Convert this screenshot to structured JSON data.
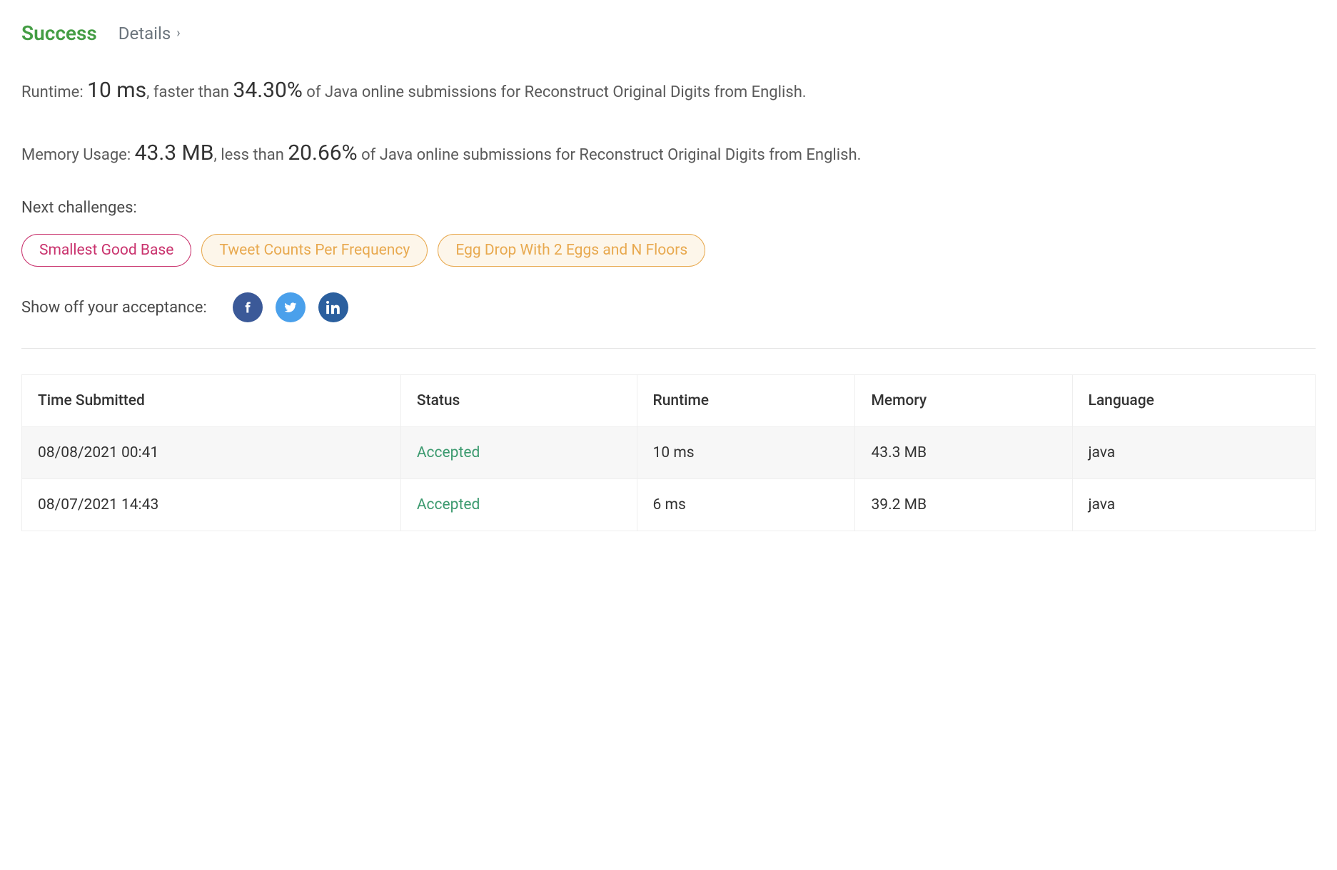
{
  "header": {
    "status": "Success",
    "details_label": "Details"
  },
  "runtime": {
    "label": "Runtime: ",
    "value": "10 ms",
    "comma": ", faster than ",
    "percent": "34.30%",
    "tail": " of Java online submissions for Reconstruct Original Digits from English."
  },
  "memory": {
    "label": "Memory Usage: ",
    "value": "43.3 MB",
    "comma": ", less than ",
    "percent": "20.66%",
    "tail": " of Java online submissions for Reconstruct Original Digits from English."
  },
  "next_challenges": {
    "label": "Next challenges:",
    "items": [
      {
        "text": "Smallest Good Base",
        "style": "pink"
      },
      {
        "text": "Tweet Counts Per Frequency",
        "style": "orange"
      },
      {
        "text": "Egg Drop With 2 Eggs and N Floors",
        "style": "orange"
      }
    ]
  },
  "share": {
    "label": "Show off your acceptance:"
  },
  "table": {
    "headers": [
      "Time Submitted",
      "Status",
      "Runtime",
      "Memory",
      "Language"
    ],
    "rows": [
      {
        "time": "08/08/2021 00:41",
        "status": "Accepted",
        "runtime": "10 ms",
        "memory": "43.3 MB",
        "language": "java"
      },
      {
        "time": "08/07/2021 14:43",
        "status": "Accepted",
        "runtime": "6 ms",
        "memory": "39.2 MB",
        "language": "java"
      }
    ]
  }
}
